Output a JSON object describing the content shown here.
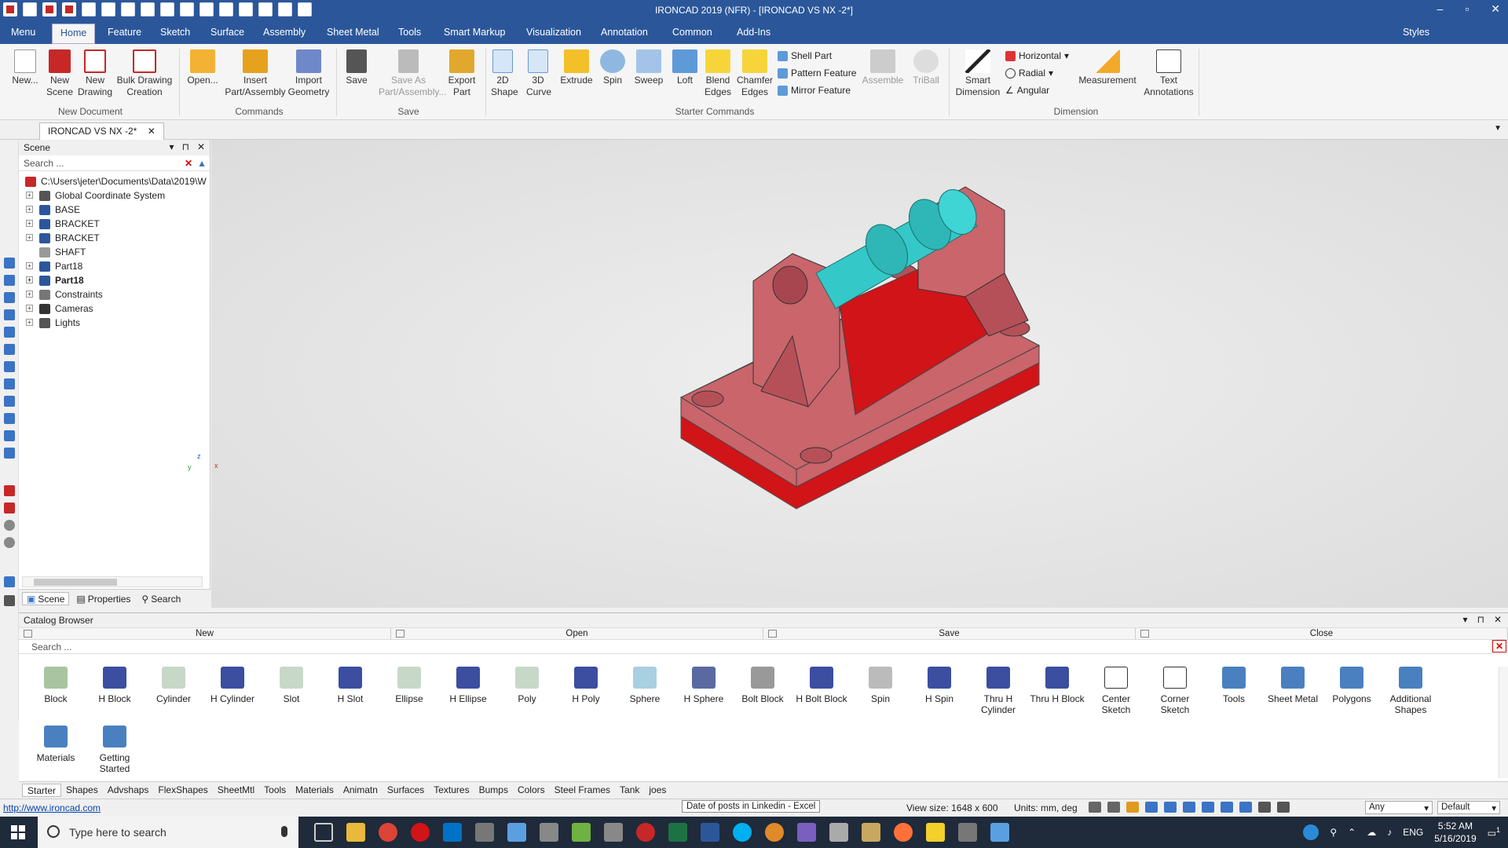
{
  "window": {
    "title": "IRONCAD 2019 (NFR) - [IRONCAD VS NX -2*]",
    "controls": [
      "–",
      "▫",
      "✕"
    ]
  },
  "menubar": {
    "items": [
      "Menu",
      "Home",
      "Feature",
      "Sketch",
      "Surface",
      "Assembly",
      "Sheet Metal",
      "Tools",
      "Smart Markup",
      "Visualization",
      "Annotation",
      "Common",
      "Add-Ins"
    ],
    "active": "Home",
    "styles_label": "Styles"
  },
  "ribbon": {
    "new_document": {
      "group_label": "New Document",
      "new": "New...",
      "new_scene": "New Scene",
      "new_drawing": "New Drawing",
      "bulk_drawing": "Bulk Drawing Creation"
    },
    "commands": {
      "group_label": "Commands",
      "open": "Open...",
      "insert": "Insert Part/Assembly",
      "import": "Import Geometry"
    },
    "save": {
      "group_label": "Save",
      "save": "Save",
      "save_as": "Save As Part/Assembly...",
      "export": "Export Part"
    },
    "starter": {
      "group_label": "Starter Commands",
      "shape2d": "2D Shape",
      "curve3d": "3D Curve",
      "extrude": "Extrude",
      "spin": "Spin",
      "sweep": "Sweep",
      "loft": "Loft",
      "blend": "Blend Edges",
      "chamfer": "Chamfer Edges",
      "shell": "Shell Part",
      "pattern": "Pattern Feature",
      "mirror": "Mirror Feature",
      "assemble": "Assemble",
      "triball": "TriBall"
    },
    "dimension": {
      "group_label": "Dimension",
      "smart": "Smart Dimension",
      "horizontal": "Horizontal",
      "radial": "Radial",
      "angular": "Angular",
      "measurement": "Measurement",
      "text_annotations": "Text Annotations"
    }
  },
  "doc_tab": "IRONCAD VS NX -2*",
  "scene": {
    "title": "Scene",
    "search_placeholder": "Search ...",
    "root": "C:\\Users\\jeter\\Documents\\Data\\2019\\W",
    "items": [
      "Global Coordinate System",
      "BASE",
      "BRACKET",
      "BRACKET",
      "SHAFT",
      "Part18",
      "Part18",
      "Constraints",
      "Cameras",
      "Lights"
    ],
    "tabs": [
      "Scene",
      "Properties",
      "Search"
    ]
  },
  "catalog": {
    "title": "Catalog Browser",
    "actions": [
      "New",
      "Open",
      "Save",
      "Close"
    ],
    "search_placeholder": "Search ...",
    "items": [
      "Block",
      "H Block",
      "Cylinder",
      "H Cylinder",
      "Slot",
      "H Slot",
      "Ellipse",
      "H Ellipse",
      "Poly",
      "H Poly",
      "Sphere",
      "H Sphere",
      "Bolt Block",
      "H Bolt Block",
      "Spin",
      "H Spin",
      "Thru H Cylinder",
      "Thru H Block",
      "Center Sketch",
      "Corner Sketch",
      "Tools",
      "Sheet Metal",
      "Polygons",
      "Additional Shapes",
      "Materials",
      "Getting Started"
    ],
    "tabs": [
      "Starter",
      "Shapes",
      "Advshaps",
      "FlexShapes",
      "SheetMtl",
      "Tools",
      "Materials",
      "Animatn",
      "Surfaces",
      "Textures",
      "Bumps",
      "Colors",
      "Steel Frames",
      "Tank",
      "joes"
    ]
  },
  "status": {
    "link": "http://www.ironcad.com",
    "tooltip": "Date of posts in Linkedin - Excel",
    "view_size": "View size: 1648 x 600",
    "units": "Units: mm, deg",
    "select_filter": "Any",
    "style_select": "Default"
  },
  "taskbar": {
    "search_placeholder": "Type here to search",
    "lang": "ENG",
    "time": "5:52 AM",
    "date": "5/16/2019",
    "notif_count": "1"
  },
  "colors": {
    "titlebar": "#2b579a",
    "part_body": "#c9656b",
    "part_base": "#d01418",
    "shaft": "#35c8c8",
    "taskbar": "#1f2a3a"
  },
  "axis": {
    "x": "x",
    "y": "y",
    "z": "z"
  }
}
